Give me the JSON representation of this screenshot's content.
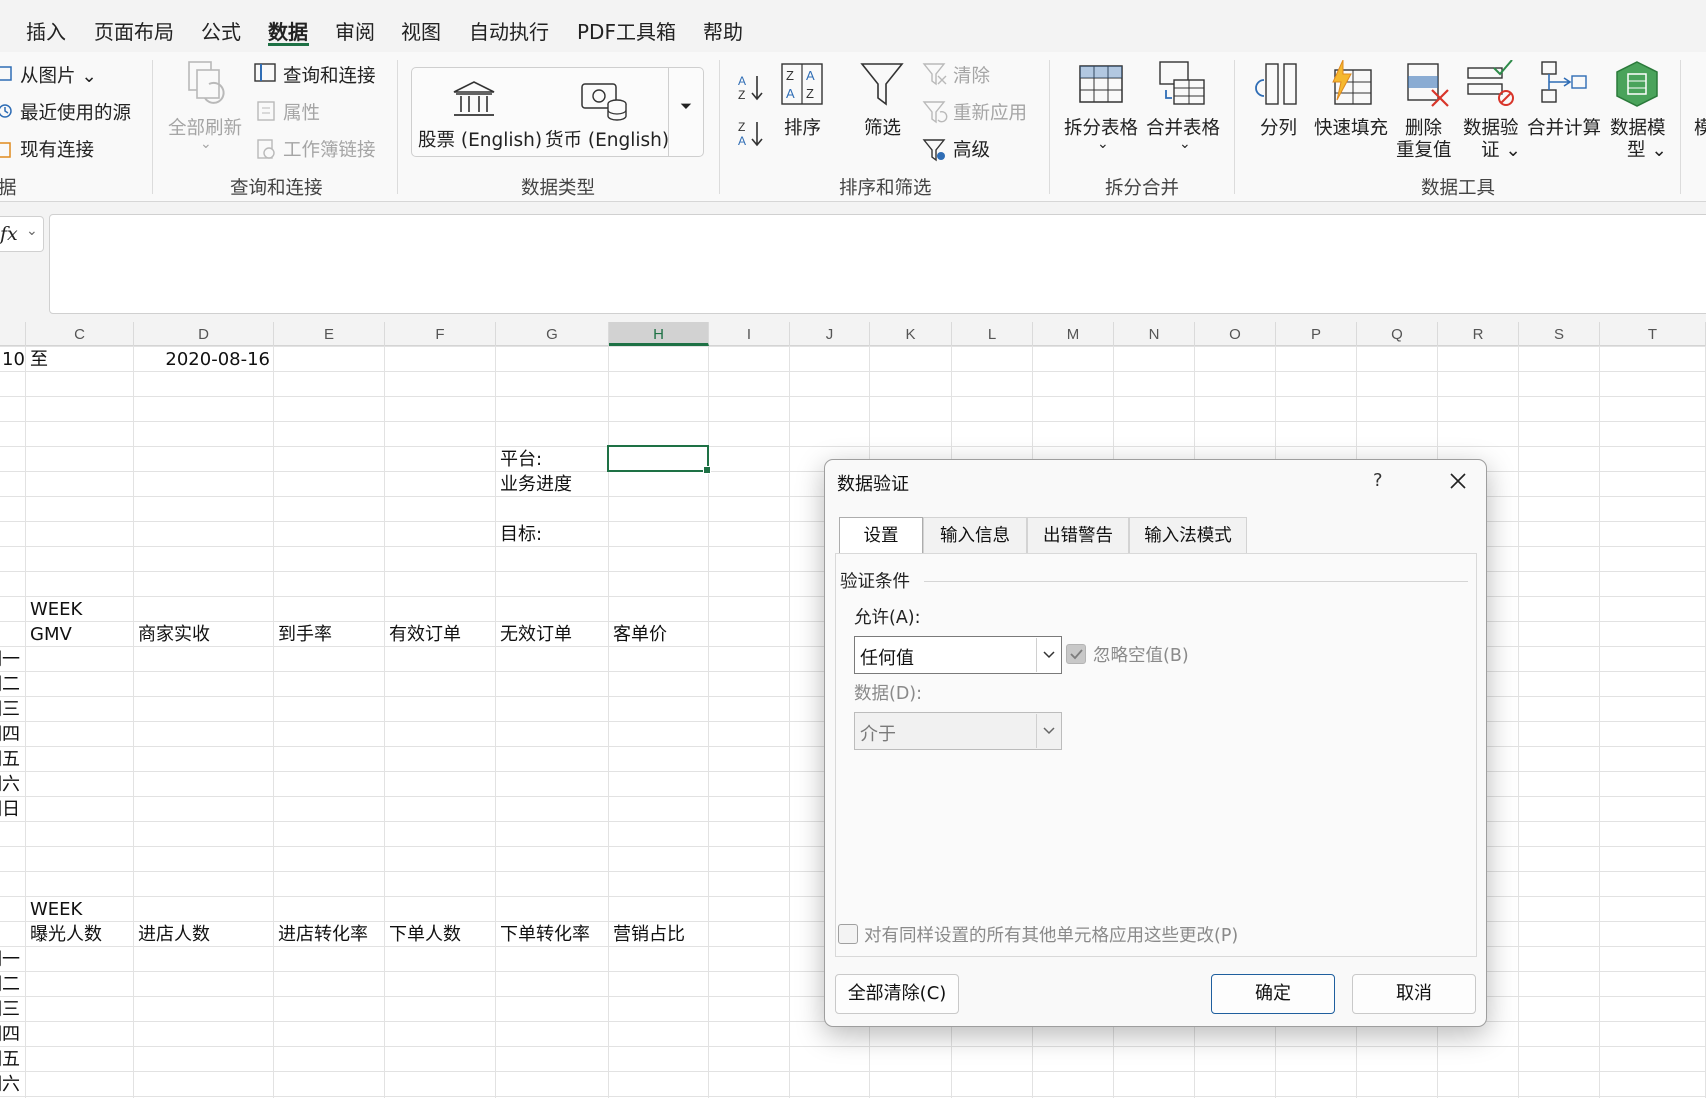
{
  "ribbon_tabs": [
    "插入",
    "页面布局",
    "公式",
    "数据",
    "审阅",
    "视图",
    "自动执行",
    "PDF工具箱",
    "帮助"
  ],
  "active_tab": "数据",
  "accent_color": "#1e7145",
  "ribbon": {
    "get_data": {
      "from_picture": "从图片",
      "recent_sources": "最近使用的源",
      "existing_connections": "现有连接",
      "group_label": "据"
    },
    "queries": {
      "refresh_all_line1": "全部刷新",
      "queries_connections": "查询和连接",
      "properties": "属性",
      "workbook_links": "工作簿链接",
      "group_label": "查询和连接"
    },
    "data_types": {
      "stocks": "股票 (English)",
      "currency": "货币 (English)",
      "group_label": "数据类型"
    },
    "sort_filter": {
      "sort": "排序",
      "filter": "筛选",
      "clear": "清除",
      "reapply": "重新应用",
      "advanced": "高级",
      "group_label": "排序和筛选"
    },
    "split_merge": {
      "split_table": "拆分表格",
      "merge_table": "合并表格",
      "group_label": "拆分合并"
    },
    "data_tools": {
      "text_to_columns": "分列",
      "flash_fill": "快速填充",
      "remove_dup_1": "删除",
      "remove_dup_2": "重复值",
      "validation_1": "数据验",
      "validation_2": "证",
      "consolidate": "合并计算",
      "model_1": "数据模",
      "model_2": "型",
      "group_label": "数据工具",
      "cut_text": "模"
    }
  },
  "formula_bar": {
    "fx_label": "fx",
    "value": ""
  },
  "columns": [
    "C",
    "D",
    "E",
    "F",
    "G",
    "H",
    "I",
    "J",
    "K",
    "L",
    "M",
    "N",
    "O",
    "P",
    "Q",
    "R",
    "S",
    "T"
  ],
  "selected_column": "H",
  "cells": {
    "b1": "10",
    "c1": "至",
    "d1": "2020-08-16",
    "g_platform": "平台:",
    "g_progress": "业务进度",
    "g_target": "目标:",
    "week1": "WEEK",
    "headers1": [
      "GMV",
      "商家实收",
      "到手率",
      "有效订单",
      "无效订单",
      "客单价"
    ],
    "days1": [
      "期一",
      "期二",
      "期三",
      "期四",
      "期五",
      "期六",
      "期日"
    ],
    "week2": "WEEK",
    "headers2": [
      "曝光人数",
      "进店人数",
      "进店转化率",
      "下单人数",
      "下单转化率",
      "营销占比"
    ],
    "days2": [
      "期一",
      "期二",
      "期三",
      "期四",
      "期五",
      "期六"
    ]
  },
  "dialog": {
    "title": "数据验证",
    "help": "?",
    "tabs": [
      "设置",
      "输入信息",
      "出错警告",
      "输入法模式"
    ],
    "active_tab": "设置",
    "section": "验证条件",
    "allow_label": "允许(A):",
    "allow_value": "任何值",
    "ignore_blank": "忽略空值(B)",
    "ignore_blank_checked": true,
    "data_label": "数据(D):",
    "data_value": "介于",
    "apply_all": "对有同样设置的所有其他单元格应用这些更改(P)",
    "clear_all": "全部清除(C)",
    "ok": "确定",
    "cancel": "取消"
  }
}
